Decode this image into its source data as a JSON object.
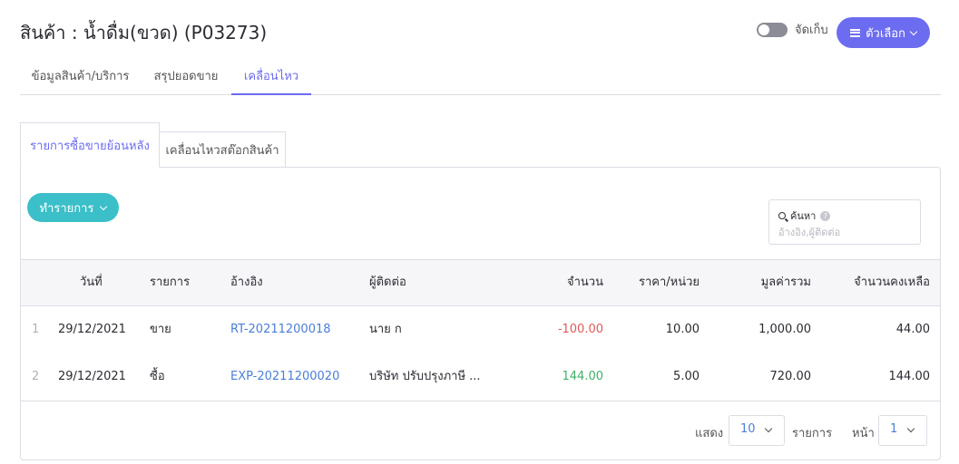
{
  "header": {
    "title": "สินค้า : น้ำดื่ม(ขวด) (P03273)",
    "archive_label": "จัดเก็บ",
    "options_label": "ตัวเลือก"
  },
  "top_tabs": [
    {
      "label": "ข้อมูลสินค้า/บริการ"
    },
    {
      "label": "สรุปยอดขาย"
    },
    {
      "label": "เคลื่อนไหว"
    }
  ],
  "sub_tabs": [
    {
      "label": "รายการซื้อขายย้อนหลัง"
    },
    {
      "label": "เคลื่อนไหวสต๊อกสินค้า"
    }
  ],
  "toolbar": {
    "action_label": "ทำรายการ",
    "search_label": "ค้นหา",
    "search_placeholder": "อ้างอิง,ผู้ติดต่อ"
  },
  "table": {
    "headers": {
      "date": "วันที่",
      "item": "รายการ",
      "ref": "อ้างอิง",
      "contact": "ผู้ติดต่อ",
      "qty": "จำนวน",
      "unit_price": "ราคา/หน่วย",
      "total": "มูลค่ารวม",
      "remaining": "จำนวนคงเหลือ"
    },
    "rows": [
      {
        "idx": "1",
        "date": "29/12/2021",
        "item": "ขาย",
        "ref": "RT-20211200018",
        "contact": "นาย ก",
        "qty": "-100.00",
        "unit_price": "10.00",
        "total": "1,000.00",
        "remaining": "44.00"
      },
      {
        "idx": "2",
        "date": "29/12/2021",
        "item": "ซื้อ",
        "ref": "EXP-20211200020",
        "contact": "บริษัท ปรับปรุงภาษี ...",
        "qty": "144.00",
        "unit_price": "5.00",
        "total": "720.00",
        "remaining": "144.00"
      }
    ]
  },
  "pagination": {
    "show_label": "แสดง",
    "page_size": "10",
    "items_label": "รายการ",
    "page_label": "หน้า",
    "page": "1"
  },
  "colors": {
    "accent": "#6c6cf0",
    "action": "#3bbfc8",
    "link": "#4a7ed8",
    "negative": "#e05a5a",
    "positive": "#3fb06a"
  }
}
